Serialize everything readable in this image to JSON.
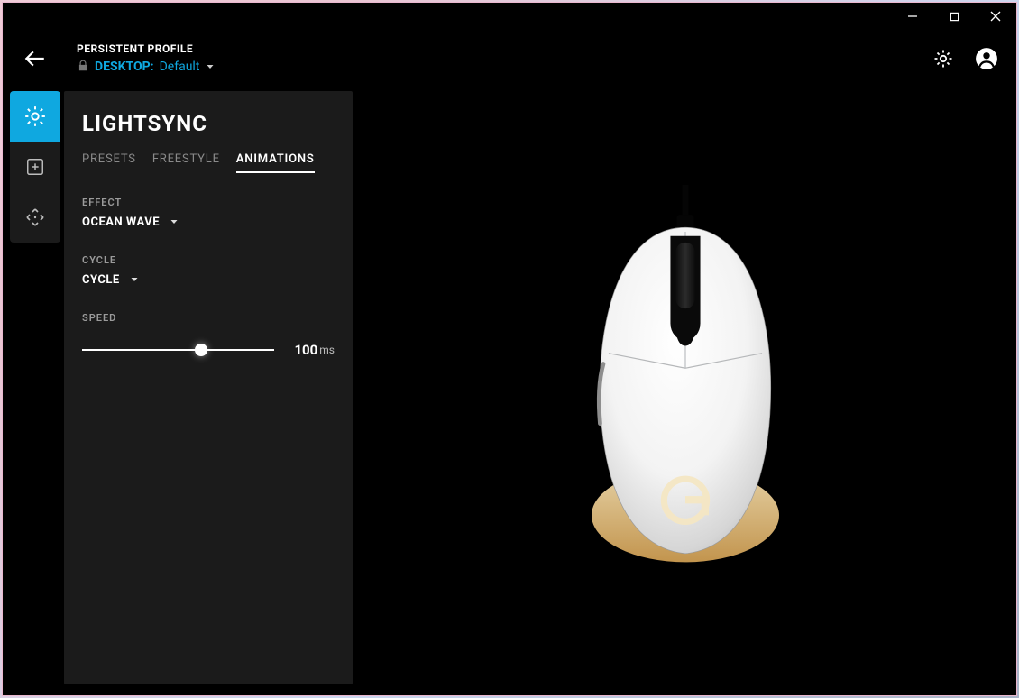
{
  "header": {
    "profile_label": "PERSISTENT PROFILE",
    "profile_prefix": "DESKTOP:",
    "profile_name": "Default"
  },
  "panel": {
    "title": "LIGHTSYNC",
    "tabs": {
      "presets": "PRESETS",
      "freestyle": "FREESTYLE",
      "animations": "ANIMATIONS"
    },
    "effect": {
      "label": "EFFECT",
      "value": "OCEAN WAVE"
    },
    "cycle": {
      "label": "CYCLE",
      "value": "CYCLE"
    },
    "speed": {
      "label": "SPEED",
      "value": "100",
      "unit": "ms",
      "percent": 62
    }
  },
  "colors": {
    "accent": "#0fa8e0"
  }
}
